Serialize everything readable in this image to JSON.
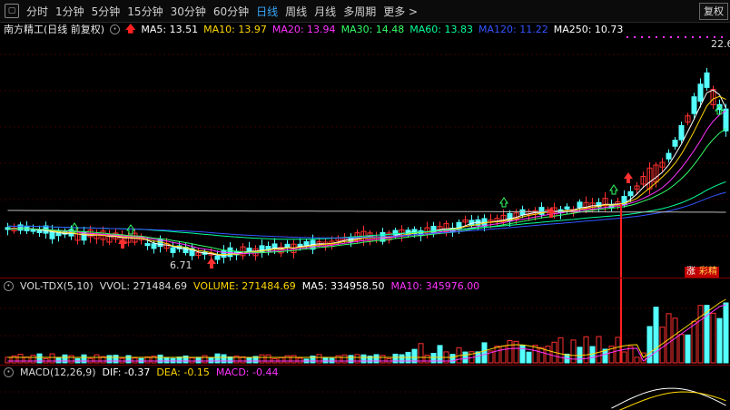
{
  "toolbar": {
    "periods": [
      "分时",
      "1分钟",
      "5分钟",
      "15分钟",
      "30分钟",
      "60分钟",
      "日线",
      "周线",
      "月线",
      "多周期",
      "更多 >"
    ],
    "active_period": "日线",
    "restore_label": "复权"
  },
  "stock": {
    "title": "南方精工(日线 前复权)"
  },
  "ma_legend": [
    {
      "label": "MA5: 13.51",
      "color": "#ffffff"
    },
    {
      "label": "MA10: 13.97",
      "color": "#ffd700"
    },
    {
      "label": "MA20: 13.94",
      "color": "#ff33ff"
    },
    {
      "label": "MA30: 14.48",
      "color": "#33ff66"
    },
    {
      "label": "MA60: 13.83",
      "color": "#00ff99"
    },
    {
      "label": "MA120: 11.22",
      "color": "#3355ff"
    },
    {
      "label": "MA250: 10.73",
      "color": "#ffffff"
    }
  ],
  "price_labels": {
    "high": "22.6",
    "low": "6.71"
  },
  "badges": {
    "zhang": "涨",
    "caixing": "彩精"
  },
  "volume": {
    "name": "VOL-TDX(5,10)",
    "items": [
      {
        "label": "VVOL: 271484.69",
        "color": "#dcdcdc"
      },
      {
        "label": "VOLUME: 271484.69",
        "color": "#ffd700"
      },
      {
        "label": "MA5: 334958.50",
        "color": "#ffffff"
      },
      {
        "label": "MA10: 345976.00",
        "color": "#ff33ff"
      }
    ]
  },
  "macd": {
    "name": "MACD(12,26,9)",
    "items": [
      {
        "label": "DIF: -0.37",
        "color": "#ffffff"
      },
      {
        "label": "DEA: -0.15",
        "color": "#ffd700"
      },
      {
        "label": "MACD: -0.44",
        "color": "#ff33ff"
      }
    ]
  },
  "colors": {
    "up": "#ff3030",
    "down": "#54ffff",
    "background": "#000000",
    "active_tab": "#39a9ff"
  }
}
